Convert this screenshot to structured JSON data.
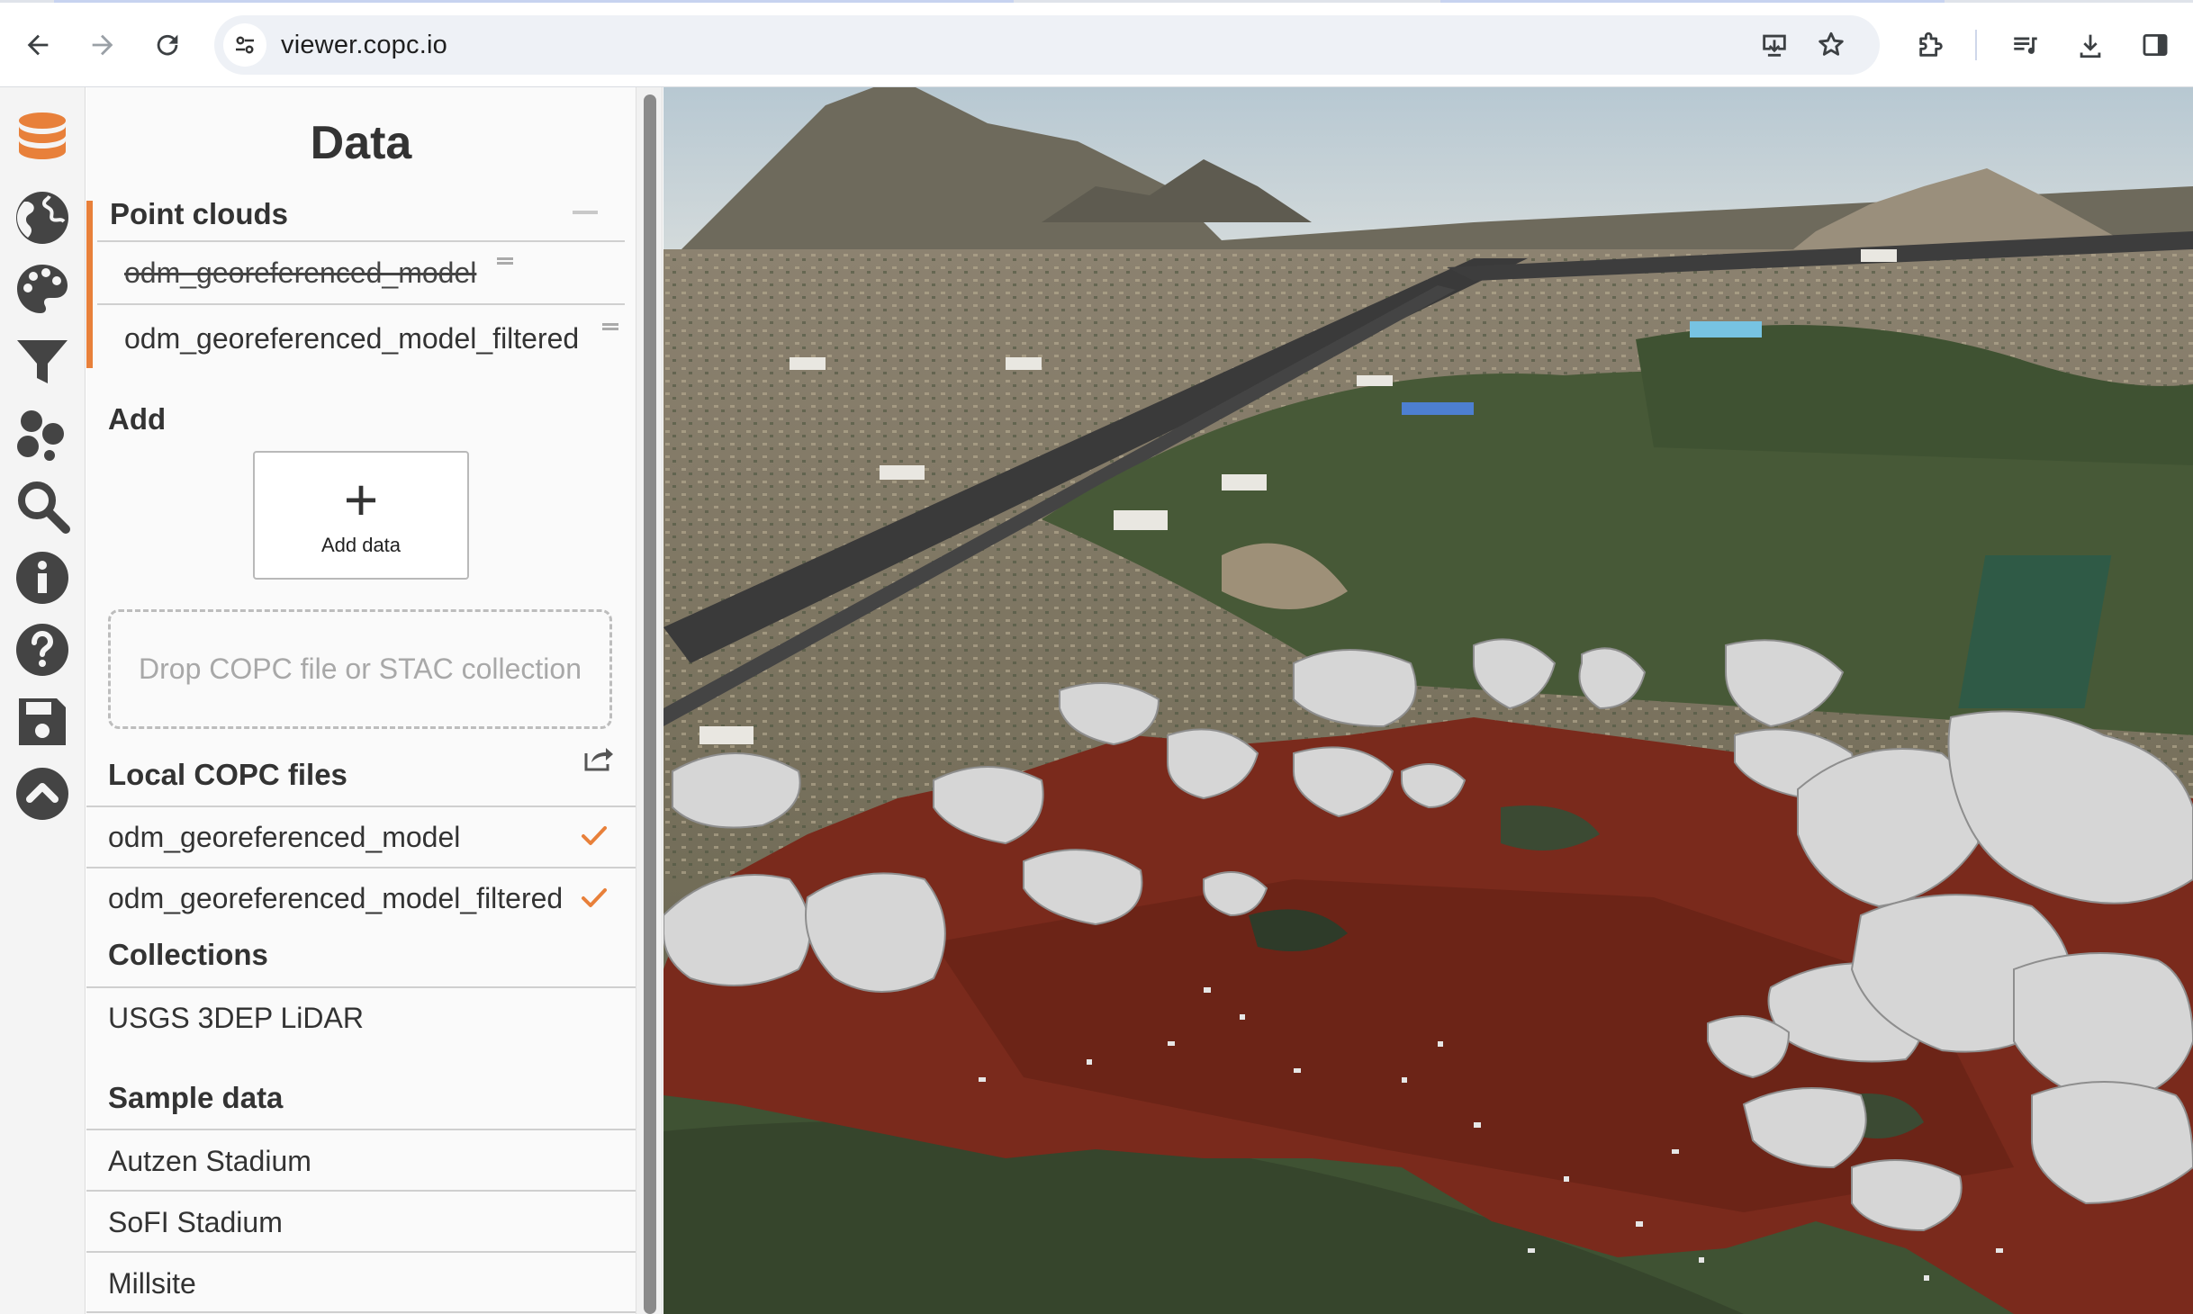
{
  "browser": {
    "url": "viewer.copc.io",
    "icons": {
      "back": "arrow-left-icon",
      "forward": "arrow-right-icon",
      "reload": "reload-icon",
      "site_info": "tune-icon",
      "install": "install-app-icon",
      "bookmark": "star-icon",
      "extensions": "puzzle-icon",
      "media": "media-queue-icon",
      "downloads": "download-icon",
      "side_panel": "side-panel-icon"
    }
  },
  "rail": {
    "accent_color": "#e8803a",
    "items": [
      {
        "name": "data",
        "icon": "database-icon",
        "active": true
      },
      {
        "name": "globe",
        "icon": "globe-icon"
      },
      {
        "name": "style",
        "icon": "palette-icon"
      },
      {
        "name": "filter",
        "icon": "filter-icon"
      },
      {
        "name": "scenes",
        "icon": "circles-icon"
      },
      {
        "name": "search",
        "icon": "search-icon"
      },
      {
        "name": "info",
        "icon": "info-icon"
      },
      {
        "name": "help",
        "icon": "help-icon"
      },
      {
        "name": "save",
        "icon": "save-icon"
      },
      {
        "name": "collapse",
        "icon": "chevron-up-icon"
      }
    ]
  },
  "panel": {
    "title": "Data",
    "point_clouds": {
      "header": "Point clouds",
      "items": [
        {
          "label": "odm_georeferenced_model",
          "hidden": true
        },
        {
          "label": "odm_georeferenced_model_filtered",
          "hidden": false
        }
      ]
    },
    "add": {
      "header": "Add",
      "button_label": "Add data",
      "button_glyph": "+",
      "drop_placeholder": "Drop COPC file or STAC collection"
    },
    "local_files": {
      "header": "Local COPC files",
      "items": [
        {
          "label": "odm_georeferenced_model",
          "checked": true
        },
        {
          "label": "odm_georeferenced_model_filtered",
          "checked": true
        }
      ]
    },
    "collections": {
      "header": "Collections",
      "items": [
        "USGS 3DEP LiDAR"
      ]
    },
    "sample_data": {
      "header": "Sample data",
      "items": [
        "Autzen Stadium",
        "SoFI Stadium",
        "Millsite"
      ]
    }
  },
  "viewport": {
    "colors": {
      "sky": "#c9d6dc",
      "terrain": "#7d7460",
      "grass": "#465837",
      "point_cloud_red": "#7a2a1c",
      "point_cloud_white": "#d9d9d9"
    }
  }
}
